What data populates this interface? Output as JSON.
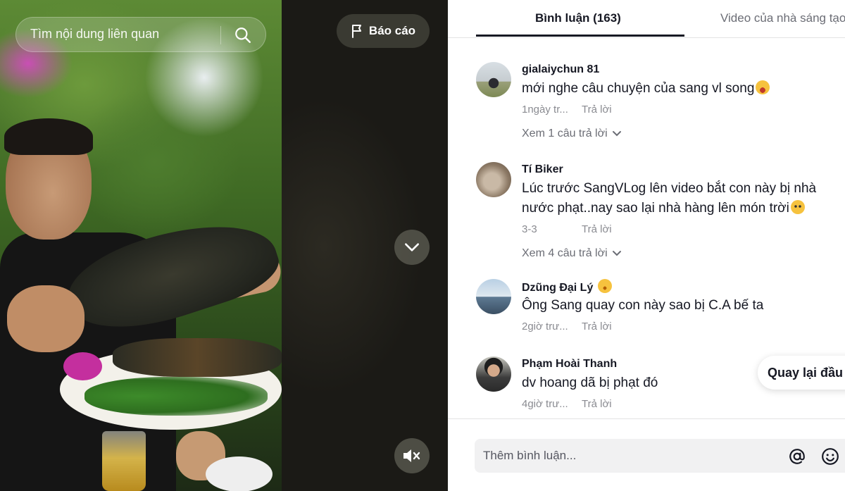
{
  "video": {
    "search_placeholder": "Tìm nội dung liên quan",
    "search_icon": "search-icon",
    "report_label": "Báo cáo",
    "report_icon": "flag-icon",
    "next_icon": "chevron-down-icon",
    "mute_icon": "speaker-muted-icon"
  },
  "tabs": {
    "comments": "Bình luận (163)",
    "creator_videos": "Video của nhà sáng tạo"
  },
  "comments": [
    {
      "username": "gialaiychun 81",
      "text": "mới nghe câu chuyện của sang vl song",
      "emoji": "laughing-emoji",
      "time": "1ngày tr...",
      "reply_label": "Trả lời",
      "view_replies": "Xem 1 câu trả lời"
    },
    {
      "username": "Tí Biker",
      "text": "Lúc trước SangVLog lên video bắt con này bị nhà nước phạt..nay sao lại nhà hàng lên món trời",
      "emoji": "flushed-emoji",
      "time": "3-3",
      "reply_label": "Trả lời",
      "view_replies": "Xem 4 câu trả lời"
    },
    {
      "username": "Dzũng Đại Lý",
      "username_emoji": "smiling-emoji",
      "text": "Ông Sang quay con này sao bị C.A bế ta",
      "time": "2giờ trư...",
      "reply_label": "Trả lời"
    },
    {
      "username": "Phạm Hoài Thanh",
      "text": "dv hoang dã bị phạt đó",
      "time": "4giờ trư...",
      "reply_label": "Trả lời"
    }
  ],
  "back_to_top": "Quay lại đầu",
  "comment_input": {
    "placeholder": "Thêm bình luận...",
    "mention_icon": "at-sign-icon",
    "emoji_icon": "emoji-face-icon"
  },
  "colors": {
    "text_primary": "#161823",
    "text_secondary": "#8a8b91",
    "divider": "#e3e3e4",
    "input_bg": "#f1f1f2"
  }
}
